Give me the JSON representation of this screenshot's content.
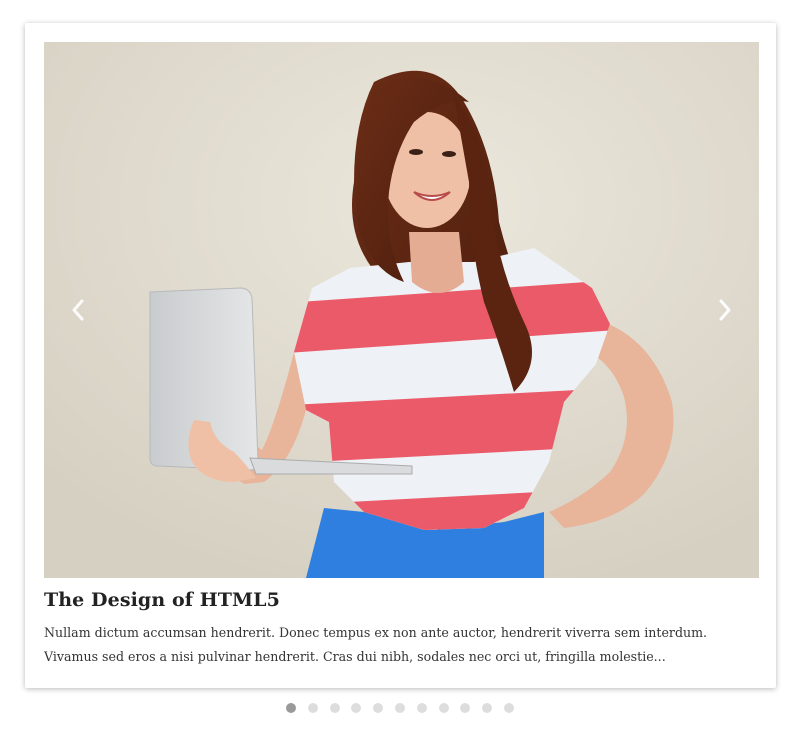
{
  "slider": {
    "title": "The Design of HTML5",
    "text": "Nullam dictum accumsan hendrerit. Donec tempus ex non ante auctor, hendrerit viverra sem interdum. Vivamus sed eros a nisi pulvinar hendrerit. Cras dui nibh, sodales nec orci ut, fringilla molestie...",
    "prev_icon": "chevron-left-icon",
    "next_icon": "chevron-right-icon",
    "slide_count": 11,
    "active_slide": 1
  },
  "colors": {
    "wall": "#e2ddd1",
    "shirt_red": "#ea5a68",
    "shirt_white": "#eef1f6",
    "skirt_blue": "#2e7fe0",
    "dot_active": "#9a9a9a",
    "dot_inactive": "#dddddd"
  }
}
